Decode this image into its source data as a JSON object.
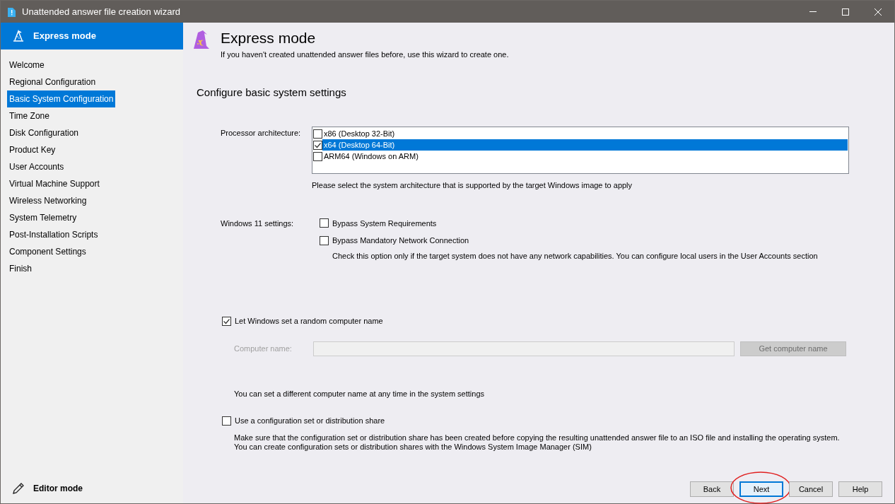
{
  "window": {
    "title": "Unattended answer file creation wizard"
  },
  "sidebar": {
    "header": "Express mode",
    "steps": [
      {
        "label": "Welcome",
        "selected": false
      },
      {
        "label": "Regional Configuration",
        "selected": false
      },
      {
        "label": "Basic System Configuration",
        "selected": true
      },
      {
        "label": "Time Zone",
        "selected": false
      },
      {
        "label": "Disk Configuration",
        "selected": false
      },
      {
        "label": "Product Key",
        "selected": false
      },
      {
        "label": "User Accounts",
        "selected": false
      },
      {
        "label": "Virtual Machine Support",
        "selected": false
      },
      {
        "label": "Wireless Networking",
        "selected": false
      },
      {
        "label": "System Telemetry",
        "selected": false
      },
      {
        "label": "Post-Installation Scripts",
        "selected": false
      },
      {
        "label": "Component Settings",
        "selected": false
      },
      {
        "label": "Finish",
        "selected": false
      }
    ],
    "footer": "Editor mode"
  },
  "header": {
    "title": "Express mode",
    "subtitle": "If you haven't created unattended answer files before, use this wizard to create one."
  },
  "section_title": "Configure basic system settings",
  "processor": {
    "label": "Processor architecture:",
    "options": [
      {
        "label": "x86 (Desktop 32-Bit)",
        "checked": false,
        "selected": false
      },
      {
        "label": "x64 (Desktop 64-Bit)",
        "checked": true,
        "selected": true
      },
      {
        "label": "ARM64 (Windows on ARM)",
        "checked": false,
        "selected": false
      }
    ],
    "hint": "Please select the system architecture that is supported by the target Windows image to apply"
  },
  "windows11": {
    "label": "Windows 11 settings:",
    "options": [
      {
        "label": "Bypass System Requirements",
        "checked": false
      },
      {
        "label": "Bypass Mandatory Network Connection",
        "checked": false
      }
    ],
    "note": "Check this option only if the target system does not have any network capabilities. You can configure local users in the User Accounts section"
  },
  "random_name": {
    "label": "Let Windows set a random computer name",
    "checked": true
  },
  "computer_name": {
    "label": "Computer name:",
    "button": "Get computer name",
    "disabled": true
  },
  "name_note": "You can set a different computer name at any time in the system settings",
  "config_share": {
    "label": "Use a configuration set or distribution share",
    "checked": false,
    "note_lines": [
      "Make sure that the configuration set or distribution share has been created before copying the resulting unattended answer file to an ISO file and installing the operating system.",
      "You can create configuration sets or distribution shares with the Windows System Image Manager (SIM)"
    ]
  },
  "buttons": [
    {
      "label": "Back",
      "focused": false,
      "circled": false
    },
    {
      "label": "Next",
      "focused": true,
      "circled": true
    },
    {
      "label": "Cancel",
      "focused": false,
      "circled": false
    },
    {
      "label": "Help",
      "focused": false,
      "circled": false
    }
  ]
}
